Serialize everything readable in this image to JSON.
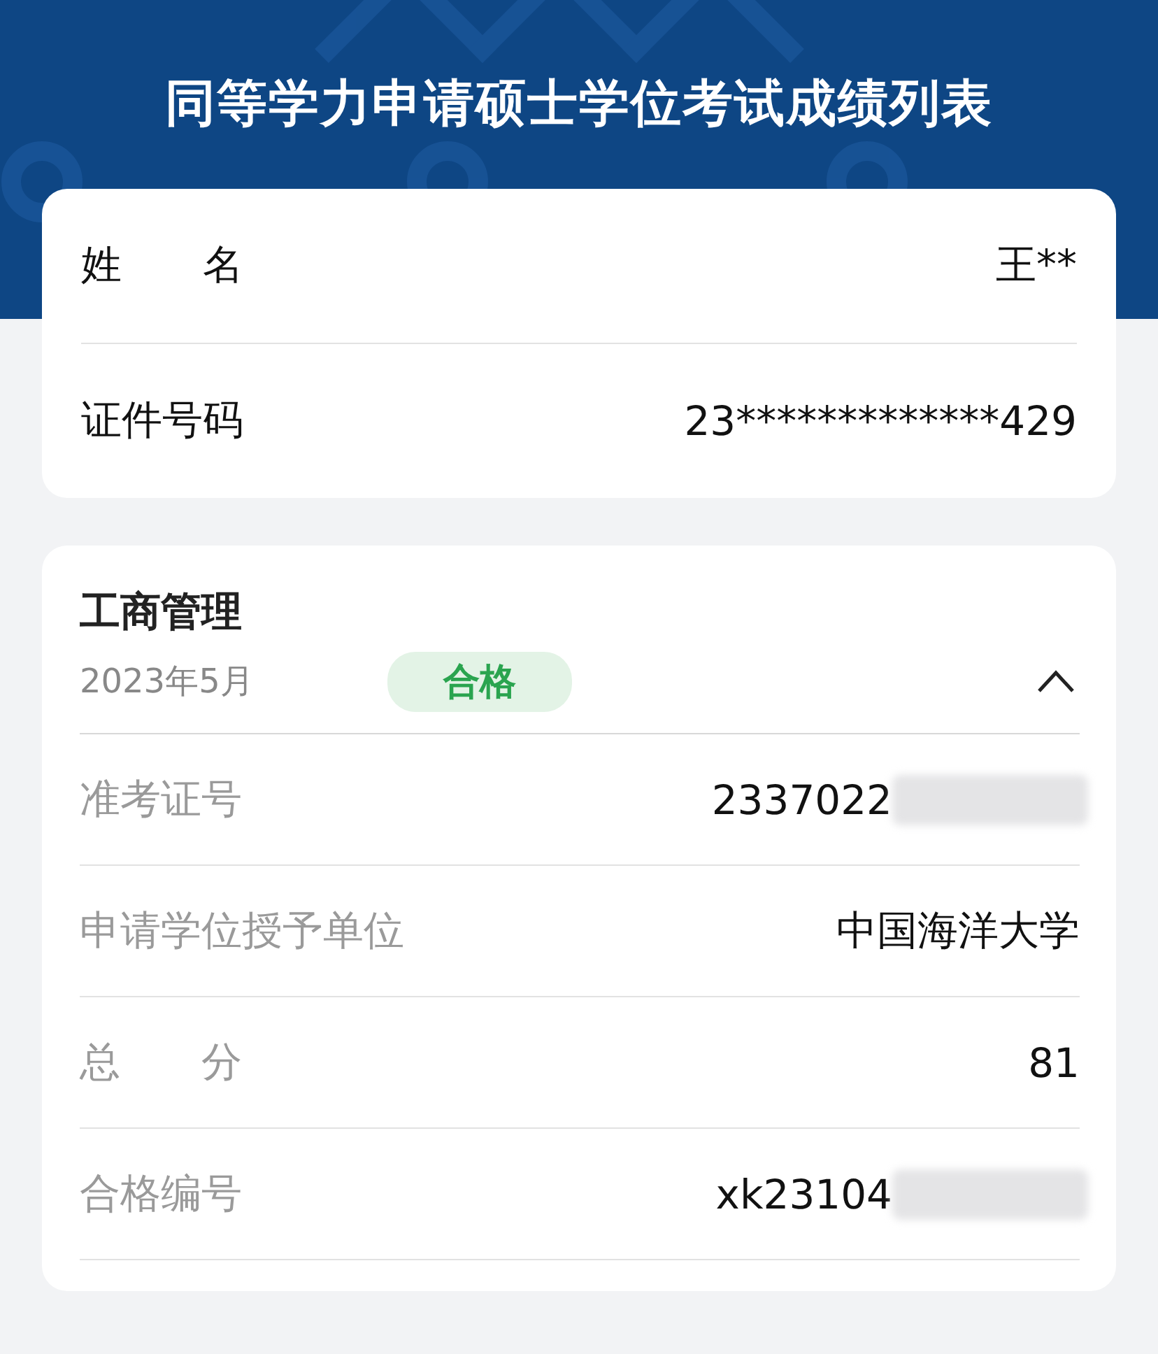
{
  "header": {
    "title": "同等学力申请硕士学位考试成绩列表"
  },
  "identity": [
    {
      "label": "姓　　名",
      "value": "王**"
    },
    {
      "label": "证件号码",
      "value": "23*************429"
    }
  ],
  "exam": {
    "subject": "工商管理",
    "date": "2023年5月",
    "result": "合格",
    "expanded": true,
    "rows": [
      {
        "label": "准考证号",
        "value": "2337022",
        "redacted": true
      },
      {
        "label": "申请学位授予单位",
        "value": "中国海洋大学",
        "redacted": false
      },
      {
        "label": "总　　分",
        "value": "81",
        "redacted": false
      },
      {
        "label": "合格编号",
        "value": "xk23104",
        "redacted": true
      }
    ]
  }
}
